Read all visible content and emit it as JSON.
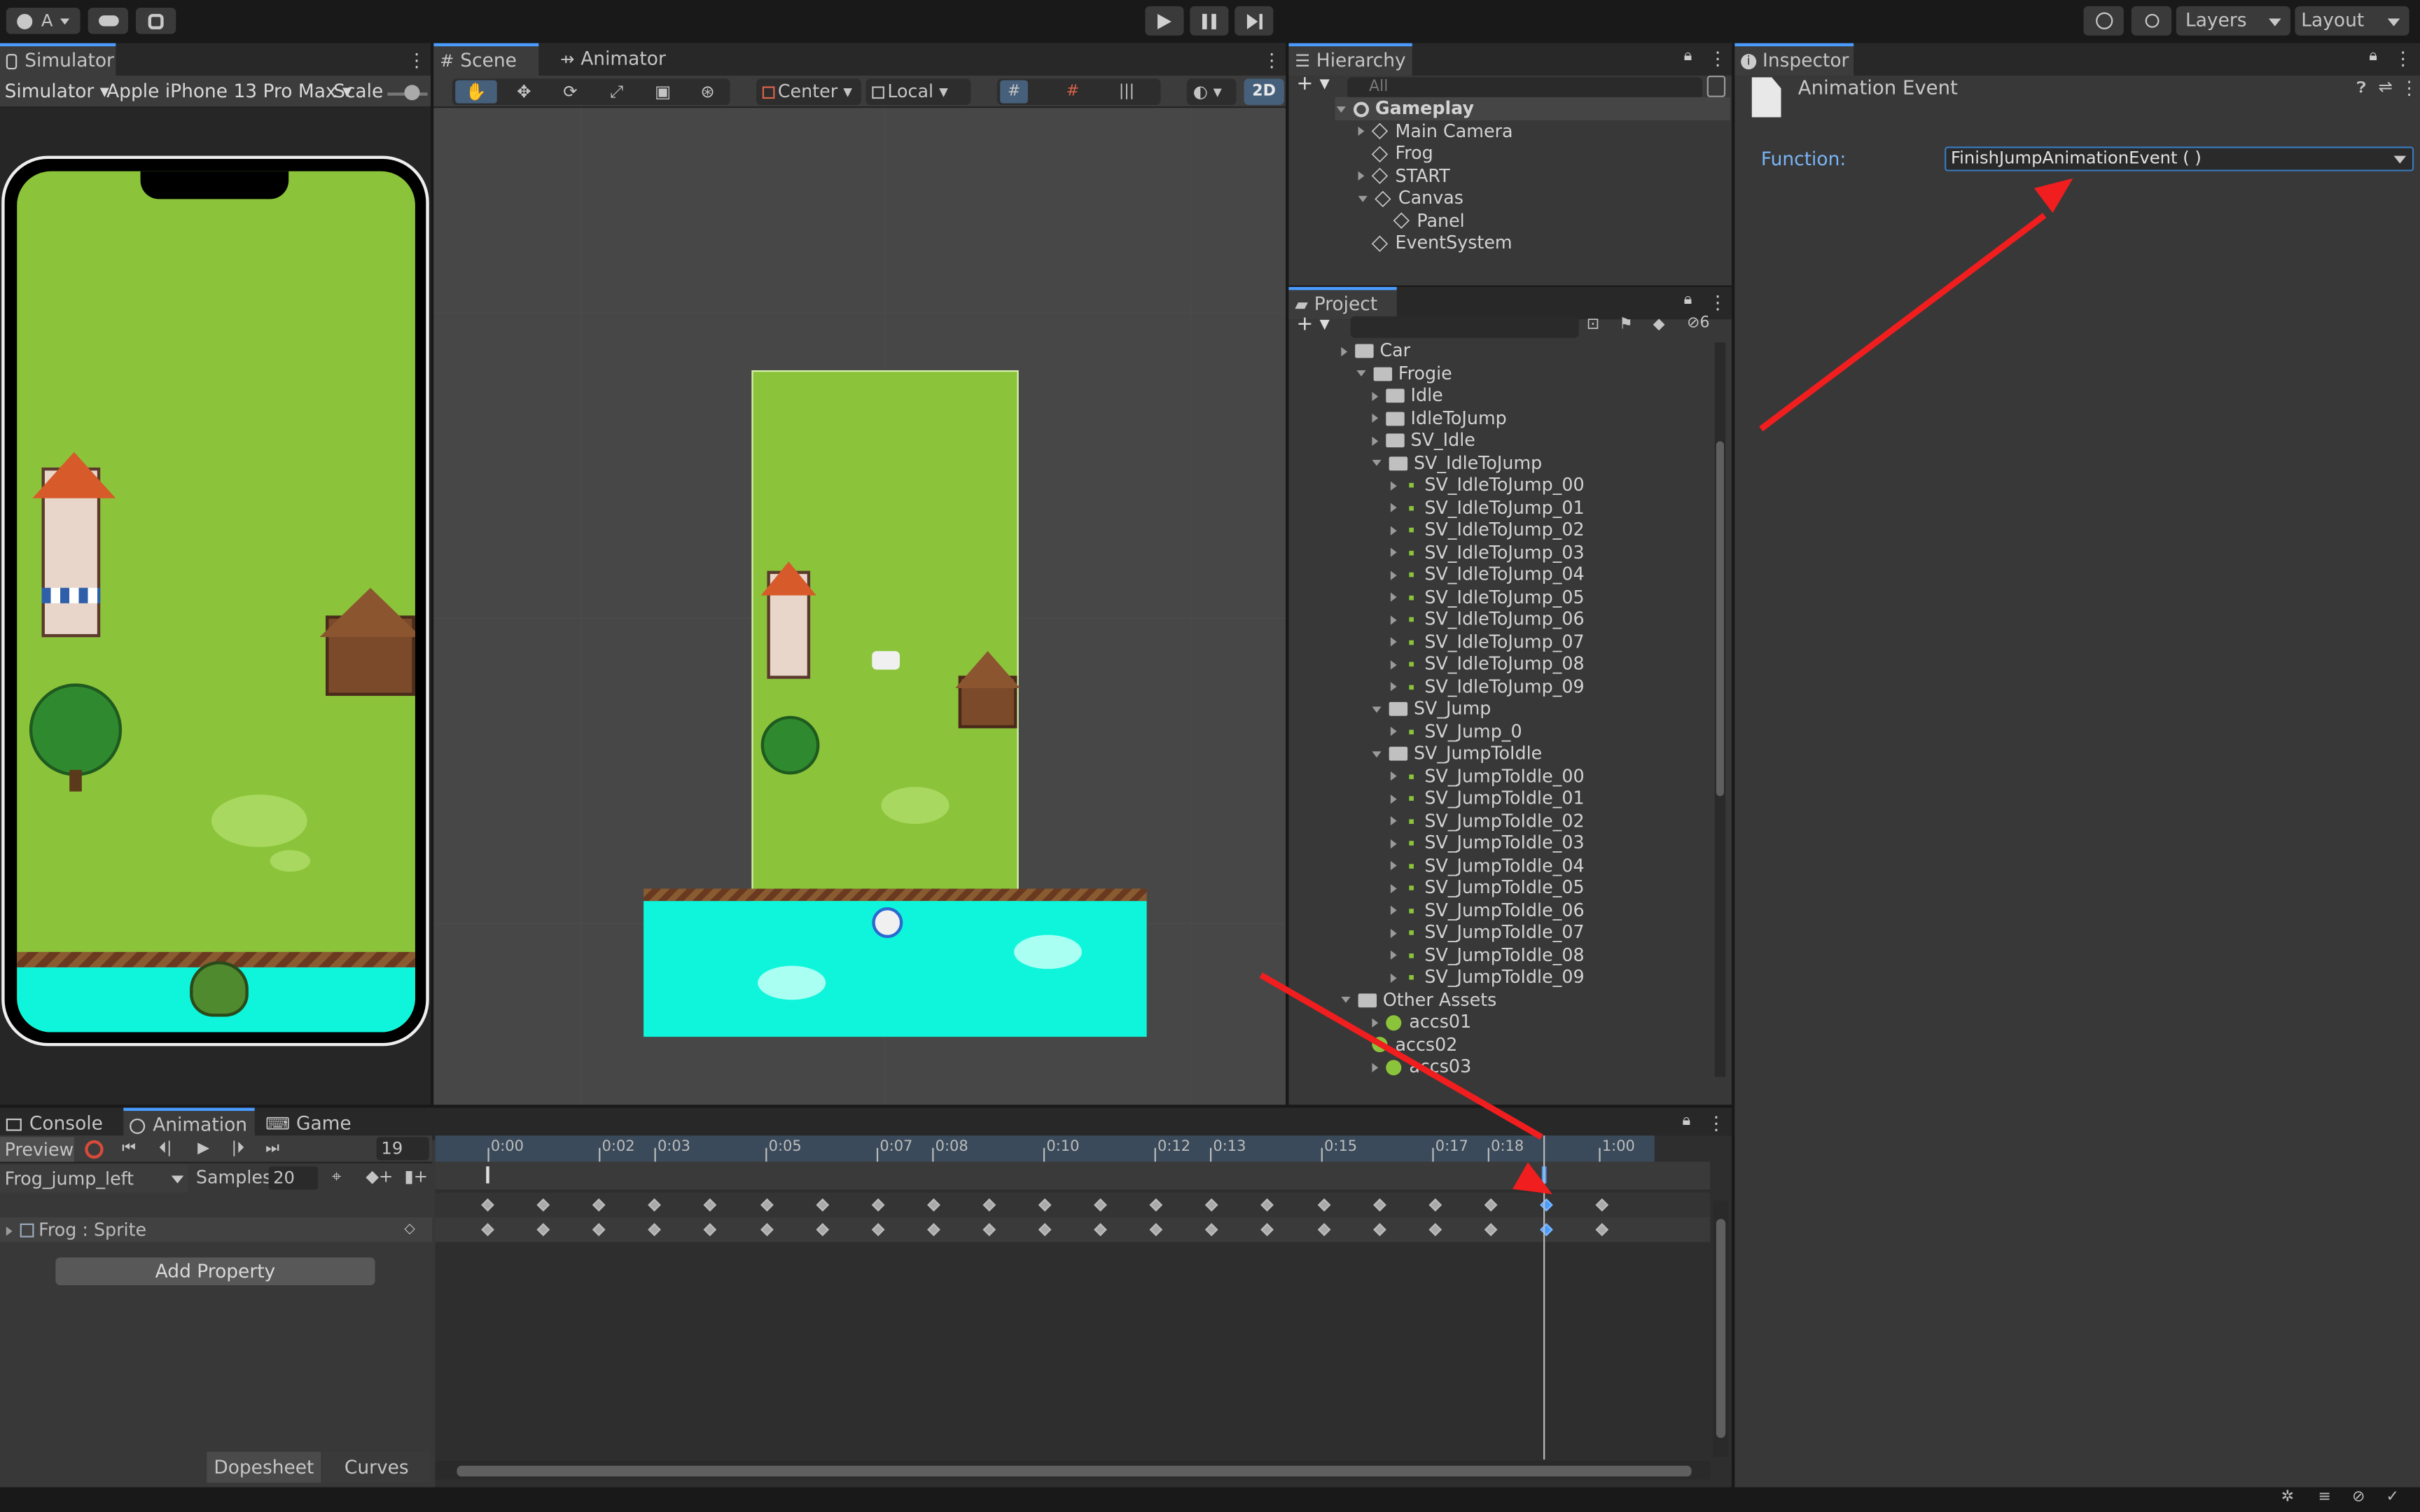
{
  "topbar": {
    "account": "A",
    "layers": "Layers",
    "layout": "Layout"
  },
  "simulator": {
    "tab": "Simulator",
    "mode": "Simulator",
    "device": "Apple iPhone 13 Pro Max",
    "scale_label": "Scale"
  },
  "scene": {
    "tab_scene": "Scene",
    "tab_animator": "Animator",
    "center": "Center",
    "local": "Local",
    "mode_2d": "2D"
  },
  "hierarchy": {
    "tab": "Hierarchy",
    "search_placeholder": "All",
    "items": [
      "Gameplay",
      "Main Camera",
      "Frog",
      "START",
      "Canvas",
      "Panel",
      "EventSystem"
    ]
  },
  "project": {
    "tab": "Project",
    "badge": "6",
    "items": [
      "Car",
      "Frogie",
      "Idle",
      "IdleToJump",
      "SV_Idle",
      "SV_IdleToJump",
      "SV_IdleToJump_00",
      "SV_IdleToJump_01",
      "SV_IdleToJump_02",
      "SV_IdleToJump_03",
      "SV_IdleToJump_04",
      "SV_IdleToJump_05",
      "SV_IdleToJump_06",
      "SV_IdleToJump_07",
      "SV_IdleToJump_08",
      "SV_IdleToJump_09",
      "SV_Jump",
      "SV_Jump_0",
      "SV_JumpToIdle",
      "SV_JumpToIdle_00",
      "SV_JumpToIdle_01",
      "SV_JumpToIdle_02",
      "SV_JumpToIdle_03",
      "SV_JumpToIdle_04",
      "SV_JumpToIdle_05",
      "SV_JumpToIdle_06",
      "SV_JumpToIdle_07",
      "SV_JumpToIdle_08",
      "SV_JumpToIdle_09",
      "Other Assets",
      "accs01",
      "accs02",
      "accs03"
    ]
  },
  "inspector": {
    "tab": "Inspector",
    "title": "Animation Event",
    "function_label": "Function:",
    "function_value": "FinishJumpAnimationEvent ( )"
  },
  "animation": {
    "tabs": [
      "Console",
      "Animation",
      "Game"
    ],
    "preview": "Preview",
    "frame": "19",
    "clip": "Frog_jump_left",
    "samples_label": "Samples",
    "samples": "20",
    "property": "Frog : Sprite",
    "add_property": "Add Property",
    "dopesheet": "Dopesheet",
    "curves": "Curves",
    "ticks": [
      "0:00",
      "0:02",
      "0:03",
      "0:05",
      "0:07",
      "0:08",
      "0:10",
      "0:12",
      "0:13",
      "0:15",
      "0:17",
      "0:18",
      "1:00"
    ]
  },
  "colors": {
    "accent": "#4a9cff",
    "grass": "#8bc43a",
    "water": "#0ff5dc",
    "arrow": "#f01e1e"
  }
}
